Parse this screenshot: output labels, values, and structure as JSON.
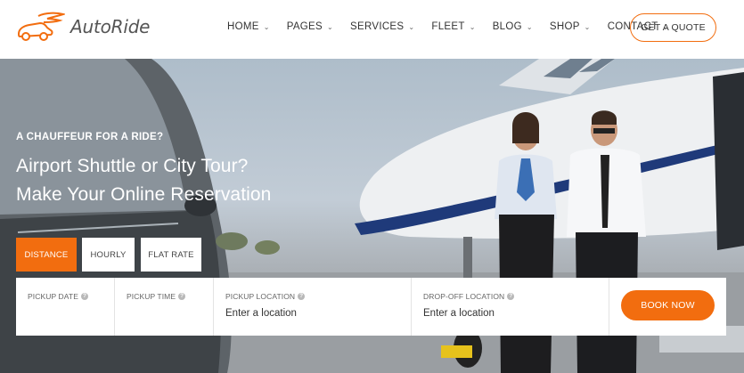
{
  "brand": {
    "name": "AutoRide",
    "accent_color": "#f26d0f"
  },
  "nav": {
    "items": [
      {
        "label": "HOME"
      },
      {
        "label": "PAGES"
      },
      {
        "label": "SERVICES"
      },
      {
        "label": "FLEET"
      },
      {
        "label": "BLOG"
      },
      {
        "label": "SHOP"
      },
      {
        "label": "CONTACT"
      }
    ],
    "quote_label": "GET A QUOTE"
  },
  "hero": {
    "kicker": "A CHAUFFEUR FOR A RIDE?",
    "title_line1": "Airport Shuttle or City Tour?",
    "title_line2": "Make Your Online Reservation"
  },
  "tabs": [
    {
      "label": "DISTANCE",
      "active": true
    },
    {
      "label": "HOURLY",
      "active": false
    },
    {
      "label": "FLAT RATE",
      "active": false
    }
  ],
  "booking": {
    "pickup_date_label": "PICKUP DATE",
    "pickup_time_label": "PICKUP TIME",
    "pickup_location_label": "PICKUP LOCATION",
    "pickup_location_placeholder": "Enter a location",
    "dropoff_location_label": "DROP-OFF LOCATION",
    "dropoff_location_placeholder": "Enter a location",
    "book_label": "BOOK NOW"
  }
}
